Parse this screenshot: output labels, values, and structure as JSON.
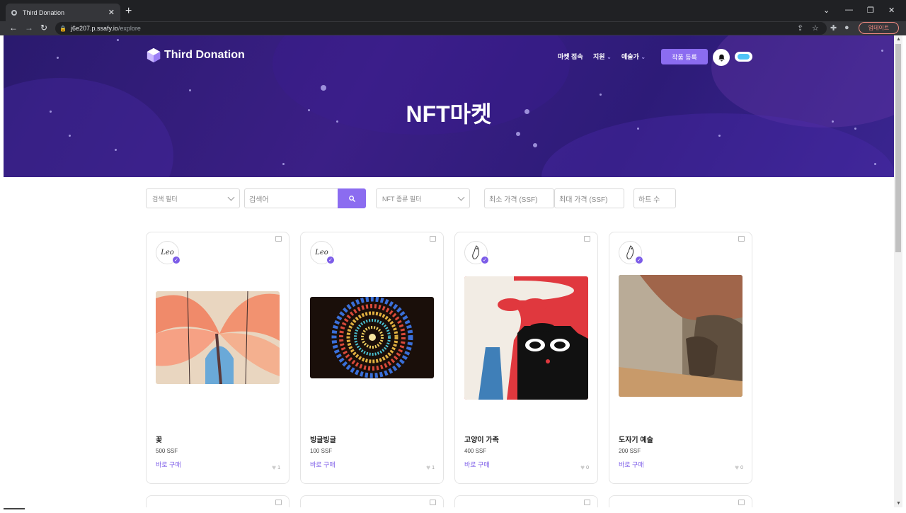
{
  "browser": {
    "tab_title": "Third Donation",
    "url_host": "j6e207.p.ssafy.io",
    "url_path": "/explore",
    "update_label": "업데이트"
  },
  "header": {
    "logo_text": "Third Donation",
    "menu": [
      {
        "label": "마켓 접속"
      },
      {
        "label": "지원"
      },
      {
        "label": "예술가"
      }
    ],
    "register_label": "작품 등록"
  },
  "hero": {
    "title": "NFT마켓"
  },
  "filters": {
    "search_filter_label": "검색 필터",
    "search_placeholder": "검색어",
    "nft_type_label": "NFT 종류 필터",
    "min_price_placeholder": "최소 가격 (SSF)",
    "max_price_placeholder": "최대 가격 (SSF)",
    "hearts_placeholder": "하트 수"
  },
  "cards": [
    {
      "name": "꽃",
      "price": "500 SSF",
      "buy_label": "바로 구매",
      "likes": "1",
      "avatar": "Leo"
    },
    {
      "name": "빙글빙글",
      "price": "100 SSF",
      "buy_label": "바로 구매",
      "likes": "1",
      "avatar": "Leo"
    },
    {
      "name": "고양이 가족",
      "price": "400 SSF",
      "buy_label": "바로 구매",
      "likes": "0",
      "avatar": ""
    },
    {
      "name": "도자기 예술",
      "price": "200 SSF",
      "buy_label": "바로 구매",
      "likes": "0",
      "avatar": ""
    }
  ],
  "colors": {
    "accent": "#8b6cf0",
    "hero_bg": "#2d1b78",
    "verified": "#7c5ce8"
  }
}
